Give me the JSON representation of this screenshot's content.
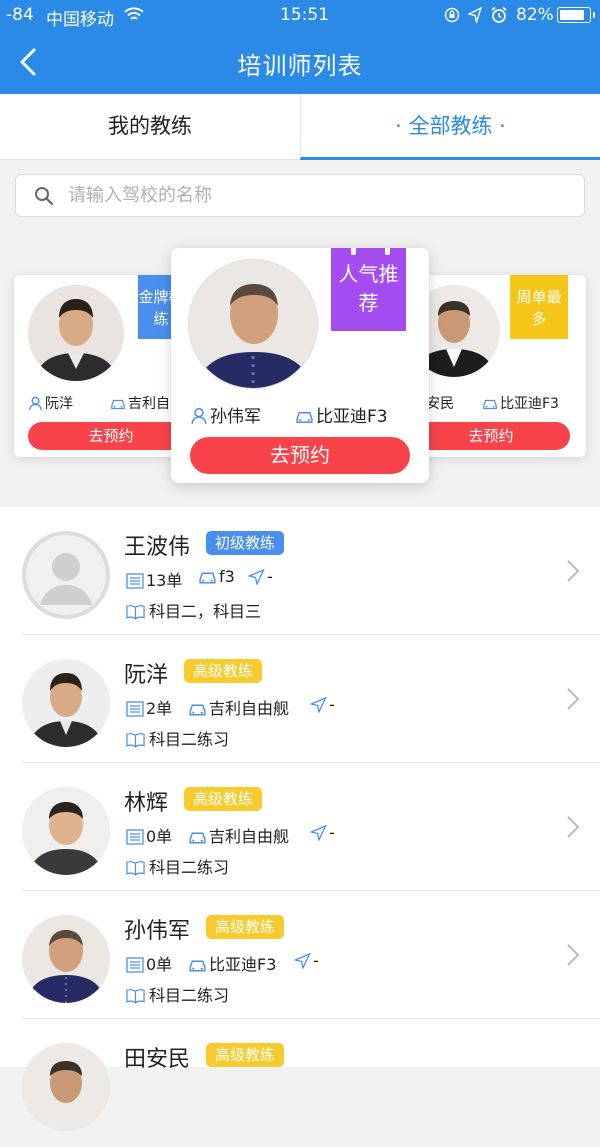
{
  "status_bar": {
    "signal": "-84",
    "carrier": "中国移动",
    "time": "15:51",
    "battery": "82%"
  },
  "header": {
    "title": "培训师列表"
  },
  "tabs": [
    {
      "label": "我的教练"
    },
    {
      "label": "· 全部教练 ·"
    }
  ],
  "search": {
    "placeholder": "请输入驾校的名称"
  },
  "featured": {
    "left": {
      "tag": "金牌教练",
      "name": "阮洋",
      "car": "吉利自由舰",
      "button": "去预约"
    },
    "center": {
      "tag": "人气推荐",
      "name": "孙伟军",
      "car": "比亚迪F3",
      "button": "去预约"
    },
    "right": {
      "tag": "周单最多",
      "name": "田安民",
      "car": "比亚迪F3",
      "button": "去预约"
    }
  },
  "coaches": [
    {
      "name": "王波伟",
      "level": "初级教练",
      "orders": "13单",
      "car": "f3",
      "distance": "-",
      "subjects": "科目二，科目三"
    },
    {
      "name": "阮洋",
      "level": "高级教练",
      "orders": "2单",
      "car": "吉利自由舰",
      "distance": "-",
      "subjects": "科目二练习"
    },
    {
      "name": "林辉",
      "level": "高级教练",
      "orders": "0单",
      "car": "吉利自由舰",
      "distance": "-",
      "subjects": "科目二练习"
    },
    {
      "name": "孙伟军",
      "level": "高级教练",
      "orders": "0单",
      "car": "比亚迪F3",
      "distance": "-",
      "subjects": "科目二练习"
    },
    {
      "name": "田安民",
      "level": "高级教练",
      "orders": "",
      "car": "",
      "distance": "",
      "subjects": ""
    }
  ],
  "colors": {
    "primary": "#2b8ae6",
    "book_button": "#f8434b",
    "tag_blue": "#4a8ef0",
    "tag_purple": "#a44cf0",
    "tag_yellow": "#f5c518",
    "level_senior": "#f7cb2d"
  }
}
